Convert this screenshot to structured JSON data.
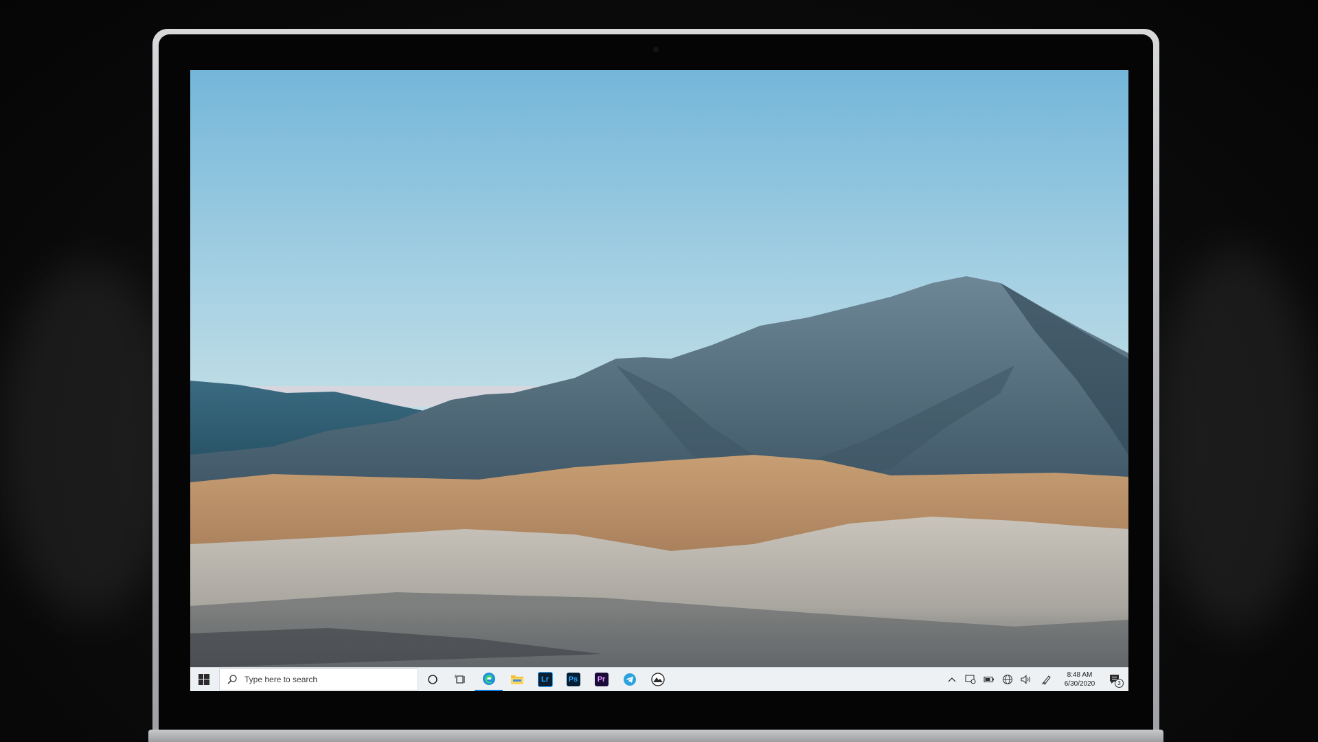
{
  "taskbar": {
    "search_placeholder": "Type here to search",
    "pinned_apps": [
      {
        "name": "Edge",
        "icon": "edge-icon"
      },
      {
        "name": "File Explorer",
        "icon": "folder-icon"
      },
      {
        "name": "Lightroom",
        "icon": "lightroom-icon",
        "glyph": "Lr"
      },
      {
        "name": "Photoshop",
        "icon": "photoshop-icon",
        "glyph": "Ps"
      },
      {
        "name": "Premiere Pro",
        "icon": "premiere-icon",
        "glyph": "Pr"
      },
      {
        "name": "Telegram",
        "icon": "telegram-icon"
      },
      {
        "name": "Photos app",
        "icon": "mountain-app-icon"
      }
    ],
    "clock": {
      "time": "8:48 AM",
      "date": "6/30/2020"
    },
    "notification_count": "3"
  },
  "colors": {
    "sky_top": "#74b6d9",
    "sky_horizon": "#e4c9d3",
    "mountain": "#4e6676",
    "grass": "#b88d61",
    "sand": "#b5b2aa",
    "taskbar": "#eef1f4",
    "lightroom": "#0b1f33",
    "photoshop": "#001e36",
    "premiere": "#1a0b39"
  }
}
